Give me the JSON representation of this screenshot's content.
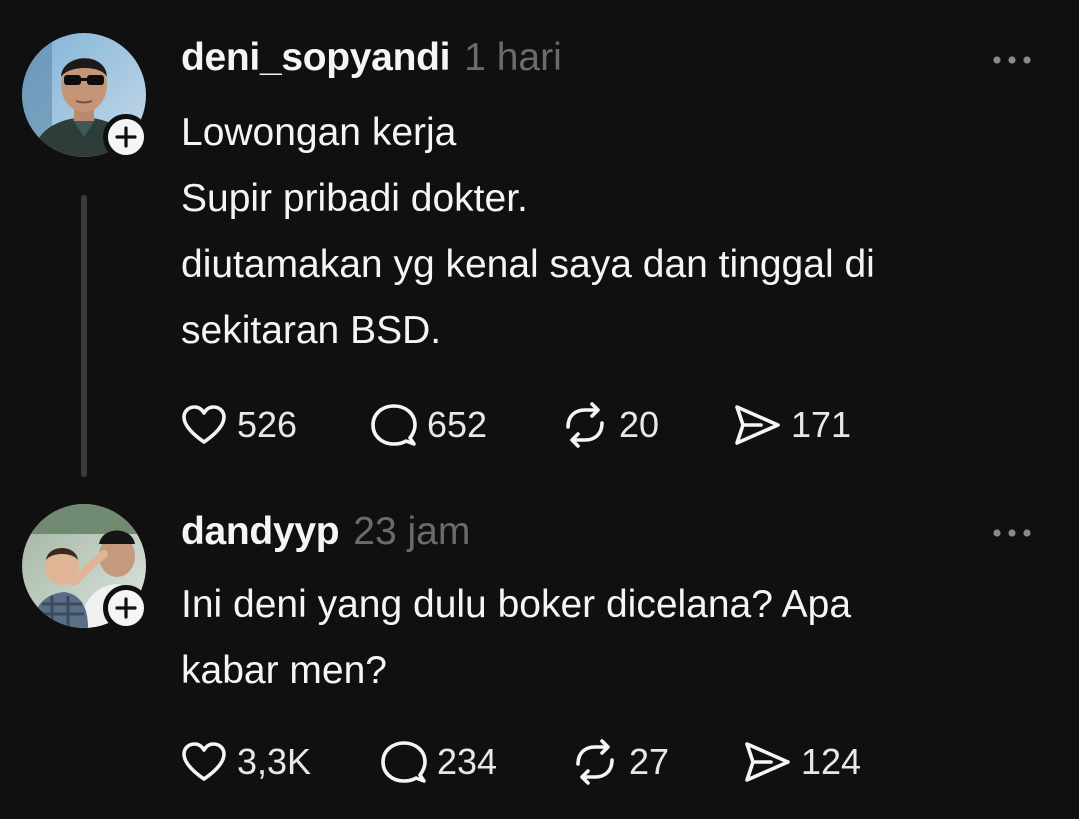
{
  "posts": [
    {
      "username": "deni_sopyandi",
      "time": "1 hari",
      "body": [
        "Lowongan kerja",
        "Supir pribadi dokter.",
        "diutamakan yg kenal saya dan tinggal di",
        "sekitaran BSD."
      ],
      "likes": "526",
      "replies": "652",
      "reposts": "20",
      "shares": "171"
    },
    {
      "username": "dandyyp",
      "time": "23 jam",
      "body": [
        "Ini deni yang dulu boker dicelana? Apa",
        "kabar men?"
      ],
      "likes": "3,3K",
      "replies": "234",
      "reposts": "27",
      "shares": "124"
    }
  ],
  "icons": {
    "like": "heart-icon",
    "reply": "comment-icon",
    "repost": "repost-icon",
    "share": "send-icon",
    "more": "more-icon",
    "follow": "plus-icon"
  },
  "colors": {
    "background": "#101010",
    "text": "#f3f5f7",
    "secondary_text": "#6b6b6b",
    "thread_line": "#3a3a3a"
  }
}
